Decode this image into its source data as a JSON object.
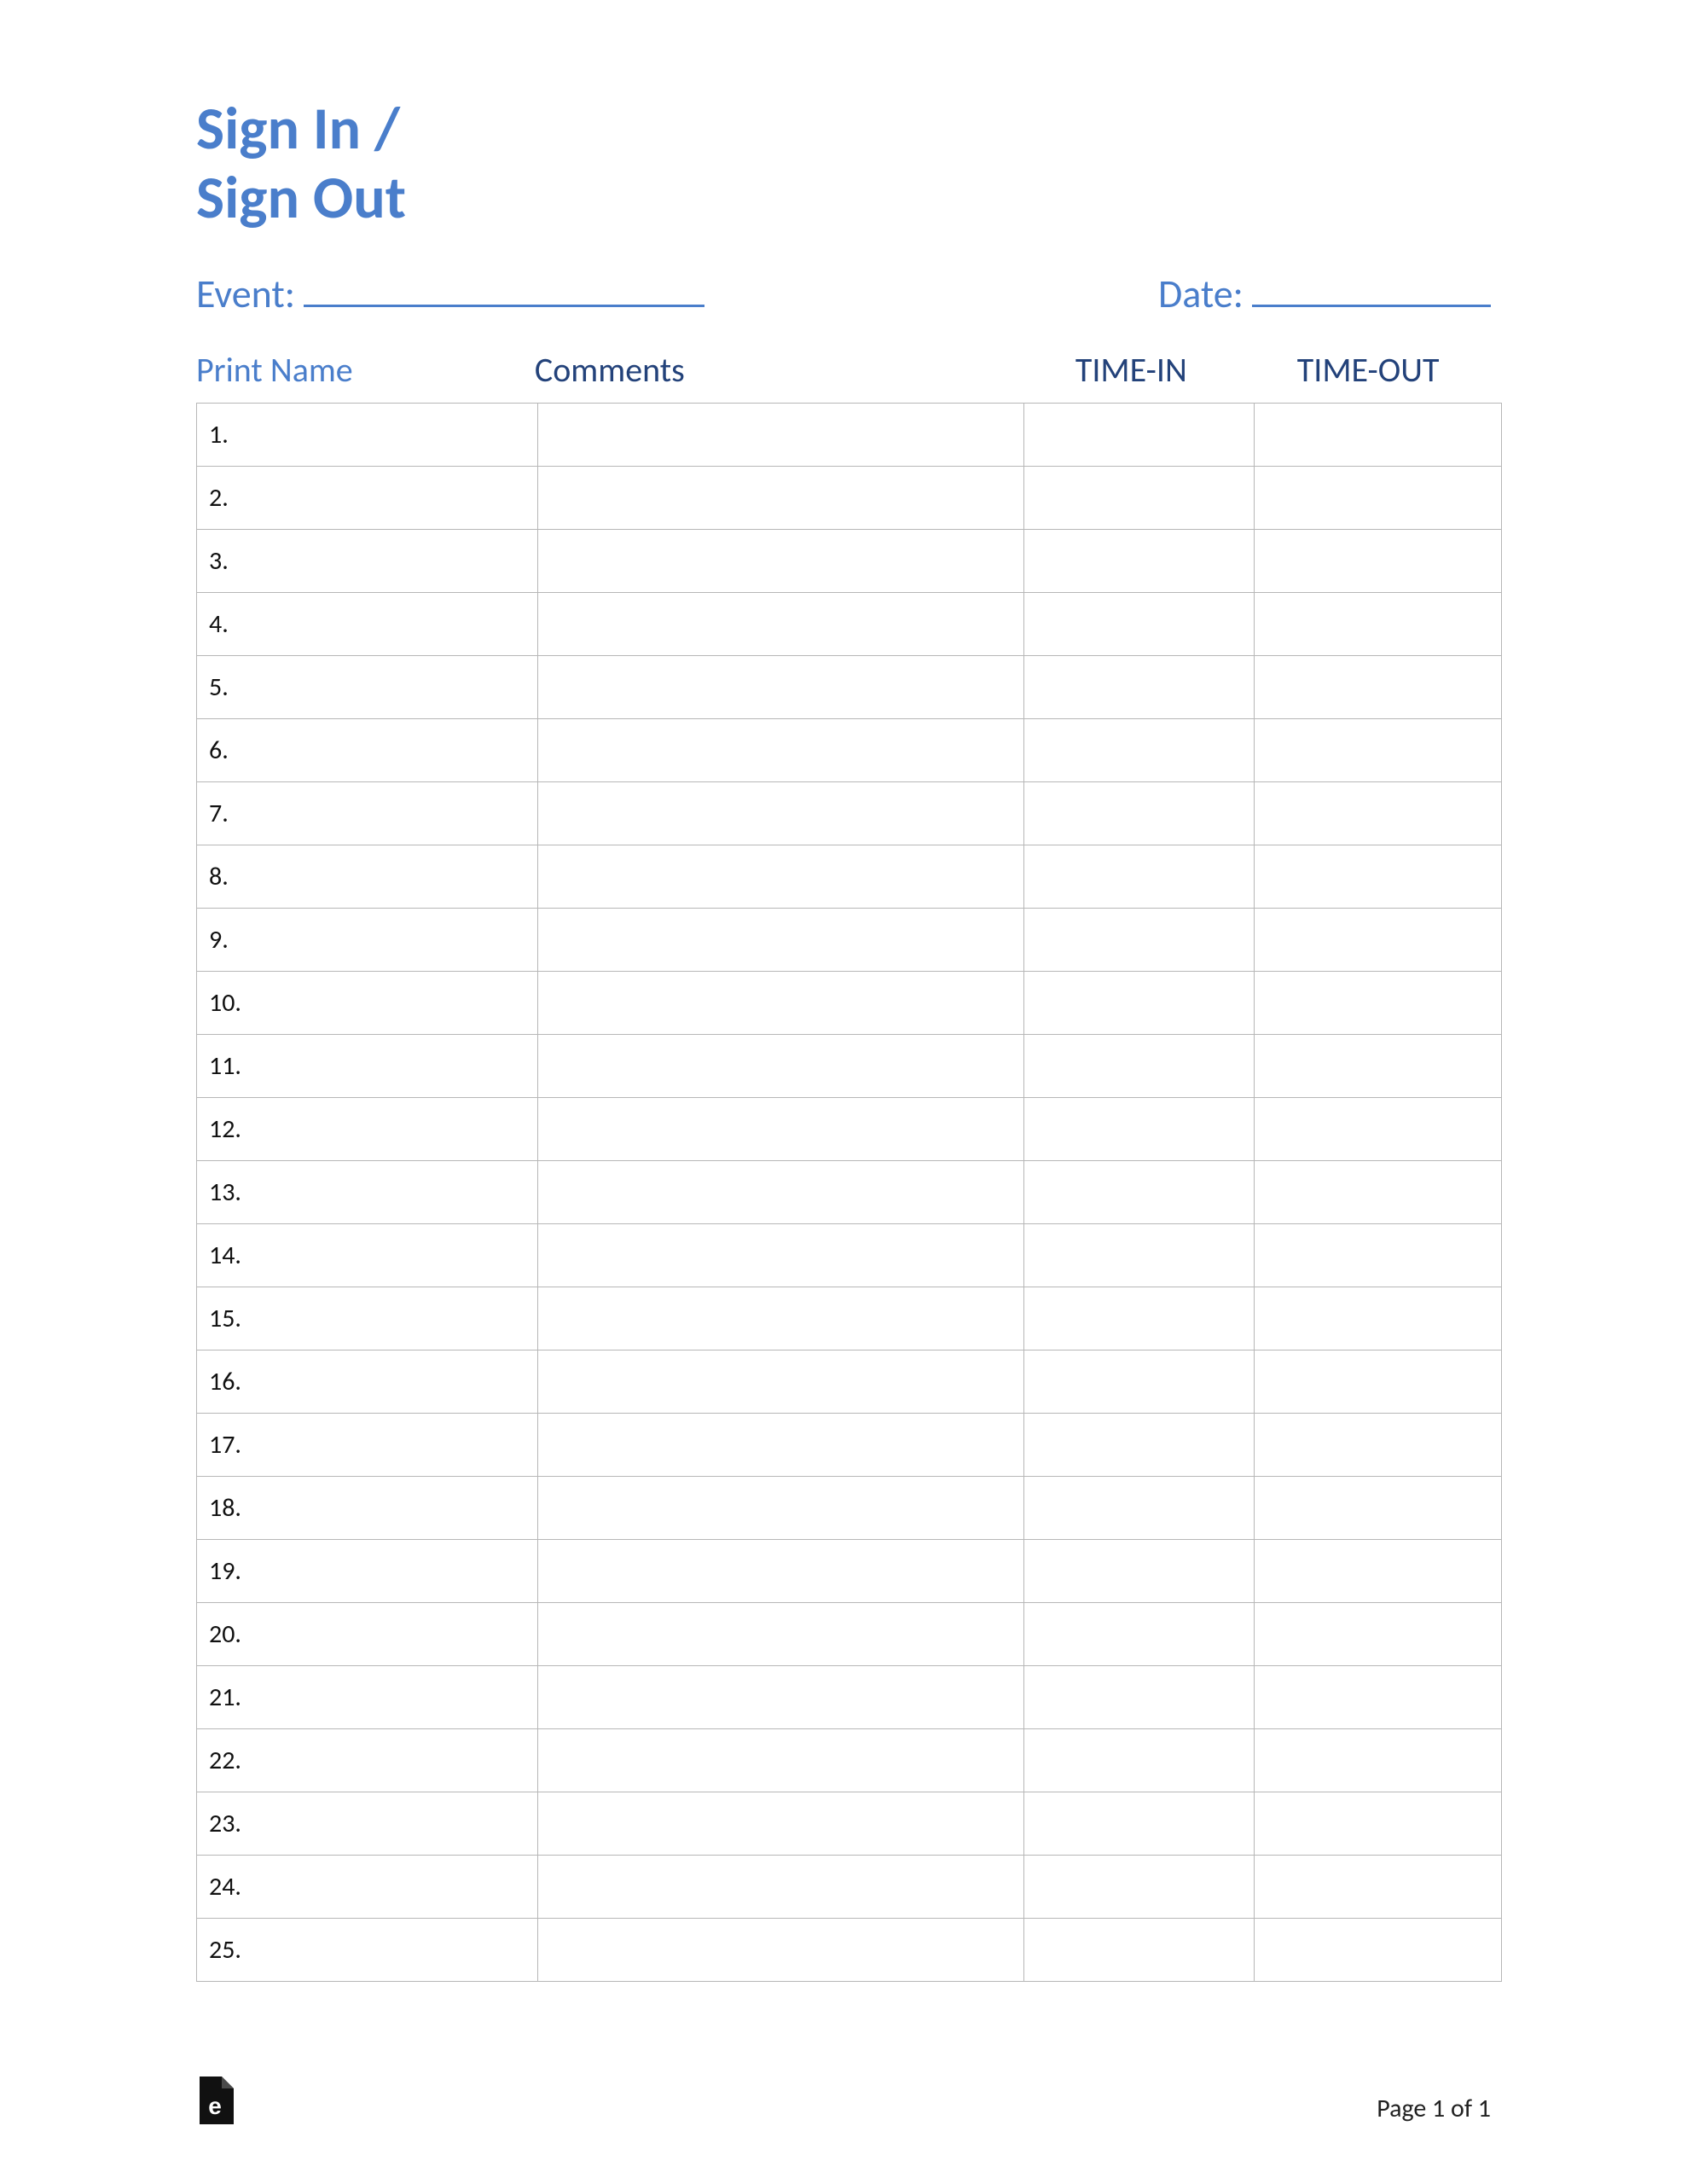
{
  "title_line1": "Sign In /",
  "title_line2": "Sign Out",
  "meta": {
    "event_label": "Event:",
    "date_label": "Date:"
  },
  "headers": {
    "name": "Print Name",
    "comments": "Comments",
    "time_in": "TIME-IN",
    "time_out": "TIME-OUT"
  },
  "rows": [
    {
      "num": "1."
    },
    {
      "num": "2."
    },
    {
      "num": "3."
    },
    {
      "num": "4."
    },
    {
      "num": "5."
    },
    {
      "num": "6."
    },
    {
      "num": "7."
    },
    {
      "num": "8."
    },
    {
      "num": "9."
    },
    {
      "num": "10."
    },
    {
      "num": "11."
    },
    {
      "num": "12."
    },
    {
      "num": "13."
    },
    {
      "num": "14."
    },
    {
      "num": "15."
    },
    {
      "num": "16."
    },
    {
      "num": "17."
    },
    {
      "num": "18."
    },
    {
      "num": "19."
    },
    {
      "num": "20."
    },
    {
      "num": "21."
    },
    {
      "num": "22."
    },
    {
      "num": "23."
    },
    {
      "num": "24."
    },
    {
      "num": "25."
    }
  ],
  "footer": {
    "page_label": "Page 1 of 1"
  }
}
